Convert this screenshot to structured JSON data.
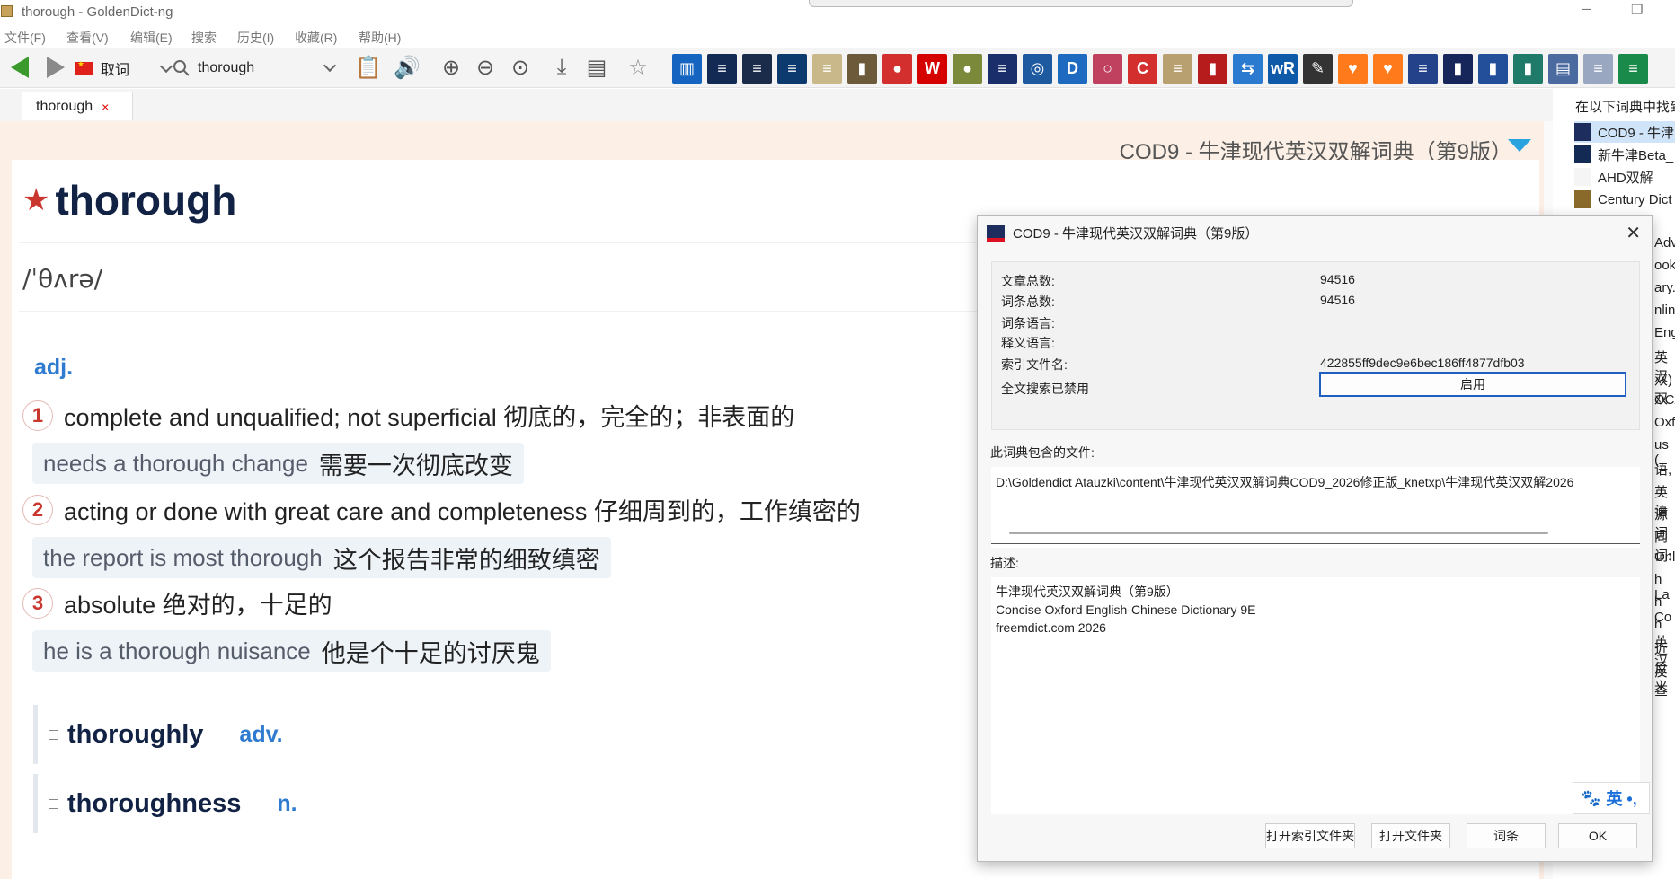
{
  "window": {
    "title": "thorough - GoldenDict-ng",
    "min": "─",
    "max": "❐"
  },
  "menu": [
    "文件(F)",
    "查看(V)",
    "编辑(E)",
    "搜索",
    "历史(I)",
    "收藏(R)",
    "帮助(H)"
  ],
  "toolbar": {
    "group_label": "取词",
    "search_value": "thorough",
    "icons": [
      "back-icon",
      "forward-icon",
      "scan-popup-icon",
      "search-icon",
      "clipboard-icon",
      "pronounce-icon",
      "zoom-in-icon",
      "zoom-out-icon",
      "zoom-reset-icon",
      "save-icon",
      "print-icon",
      "favorite-icon"
    ]
  },
  "dictionary_bar": [
    {
      "name": "stats-dict-icon",
      "color": "#1565c0",
      "glyph": "▥"
    },
    {
      "name": "oxford-dict-icon-1",
      "color": "#132a55",
      "glyph": "≡"
    },
    {
      "name": "oxford-dict-icon-2",
      "color": "#1b2c4b",
      "glyph": "≡"
    },
    {
      "name": "oxford-dict-icon-3",
      "color": "#0d3a6e",
      "glyph": "≡"
    },
    {
      "name": "thesaurus-dict-icon",
      "color": "#c9b98a",
      "glyph": "≡"
    },
    {
      "name": "book-dict-icon",
      "color": "#6d5a3a",
      "glyph": "▮"
    },
    {
      "name": "seal-dict-icon",
      "color": "#d32f2f",
      "glyph": "●"
    },
    {
      "name": "mcdonalds-dict-icon",
      "color": "#d50000",
      "glyph": "W"
    },
    {
      "name": "olive-dict-icon",
      "color": "#7a8a3a",
      "glyph": "●"
    },
    {
      "name": "oxford-dict-icon-4",
      "color": "#1a2e6b",
      "glyph": "≡"
    },
    {
      "name": "world-dict-icon",
      "color": "#1e5aa0",
      "glyph": "◎"
    },
    {
      "name": "wave-dict-icon",
      "color": "#1e6ac0",
      "glyph": "D"
    },
    {
      "name": "circle-dict-icon",
      "color": "#c04060",
      "glyph": "○"
    },
    {
      "name": "collins-dict-icon",
      "color": "#d32f2f",
      "glyph": "C"
    },
    {
      "name": "tan-dict-icon",
      "color": "#b8a070",
      "glyph": "≡"
    },
    {
      "name": "red-book-dict-icon",
      "color": "#b71c1c",
      "glyph": "▮"
    },
    {
      "name": "translate-dict-icon",
      "color": "#2a7ad0",
      "glyph": "⇆"
    },
    {
      "name": "wordreference-dict-icon",
      "color": "#0f5aa8",
      "glyph": "wR"
    },
    {
      "name": "pen-dict-icon",
      "color": "#333333",
      "glyph": "✎"
    },
    {
      "name": "heart-dict-icon-1",
      "color": "#ff7a1a",
      "glyph": "♥"
    },
    {
      "name": "heart-dict-icon-2",
      "color": "#ff7a1a",
      "glyph": "♥"
    },
    {
      "name": "oxford-dict-icon-5",
      "color": "#23428a",
      "glyph": "≡"
    },
    {
      "name": "navy-dict-icon",
      "color": "#17265a",
      "glyph": "▮"
    },
    {
      "name": "blue-book-dict-icon",
      "color": "#234f9a",
      "glyph": "▮"
    },
    {
      "name": "teal-dict-icon",
      "color": "#1f7a6a",
      "glyph": "▮"
    },
    {
      "name": "stack-dict-icon",
      "color": "#4a6aa0",
      "glyph": "▤"
    },
    {
      "name": "white-dict-icon",
      "color": "#9aa7c0",
      "glyph": "≡"
    },
    {
      "name": "green-dict-icon",
      "color": "#1a8a4a",
      "glyph": "≡"
    }
  ],
  "tabs": [
    {
      "label": "thorough",
      "close": "×"
    }
  ],
  "article": {
    "dict_title": "COD9 - 牛津现代英汉双解词典（第9版）",
    "headword": "thorough",
    "star": "★",
    "phonetic": "/ˈθʌrə/",
    "pos": "adj.",
    "senses": [
      {
        "num": "1",
        "text": "complete and unqualified; not superficial 彻底的，完全的；非表面的",
        "example_en": "needs a thorough change",
        "example_zh": "需要一次彻底改变"
      },
      {
        "num": "2",
        "text": "acting or done with great care and completeness 仔细周到的，工作缜密的",
        "example_en": "the report is most thorough",
        "example_zh": "这个报告非常的细致缜密"
      },
      {
        "num": "3",
        "text": "absolute 绝对的，十足的",
        "example_en": "he is a thorough nuisance",
        "example_zh": "他是个十足的讨厌鬼"
      }
    ],
    "derived": [
      {
        "word": "thoroughly",
        "pos": "adv."
      },
      {
        "word": "thoroughness",
        "pos": "n."
      }
    ]
  },
  "right_pane": {
    "title": "在以下词典中找到",
    "items": [
      {
        "label": "COD9 - 牛津",
        "color": "#1d2e5e"
      },
      {
        "label": "新牛津Beta_",
        "color": "#132a55"
      },
      {
        "label": "AHD双解",
        "color": "#f5f5f5"
      },
      {
        "label": "Century Dict",
        "color": "#8a6a2a"
      }
    ],
    "peek": [
      "Adv",
      "ook",
      "ary.c",
      "nlin",
      "Engl",
      "英汉",
      "双)双",
      "OCA",
      "Oxfo",
      "us (",
      "语,",
      "英语",
      "源词",
      "同词:",
      "Online",
      "h La",
      "h Co",
      "h英汉",
      "近反义",
      "反查"
    ]
  },
  "dialog": {
    "title": "COD9 - 牛津现代英汉双解词典（第9版）",
    "close": "✕",
    "rows": [
      {
        "label": "文章总数:",
        "value": "94516"
      },
      {
        "label": "词条总数:",
        "value": "94516"
      },
      {
        "label": "词条语言:",
        "value": ""
      },
      {
        "label": "释义语言:",
        "value": ""
      },
      {
        "label": "索引文件名:",
        "value": "422855ff9dec9e6bec186ff4877dfb03"
      },
      {
        "label": "全文搜索已禁用",
        "value": ""
      }
    ],
    "enable_button": "启用",
    "files_label": "此词典包含的文件:",
    "files_path": "D:\\Goldendict Atauzki\\content\\牛津现代英汉双解词典COD9_2026修正版_knetxp\\牛津现代英汉双解2026",
    "desc_label": "描述:",
    "desc_lines": [
      "牛津现代英汉双解词典（第9版）",
      "Concise Oxford English-Chinese Dictionary 9E",
      "freemdict.com 2026"
    ],
    "ime": "英 •,",
    "buttons": [
      "打开索引文件夹",
      "打开文件夹",
      "词条",
      "OK"
    ]
  }
}
